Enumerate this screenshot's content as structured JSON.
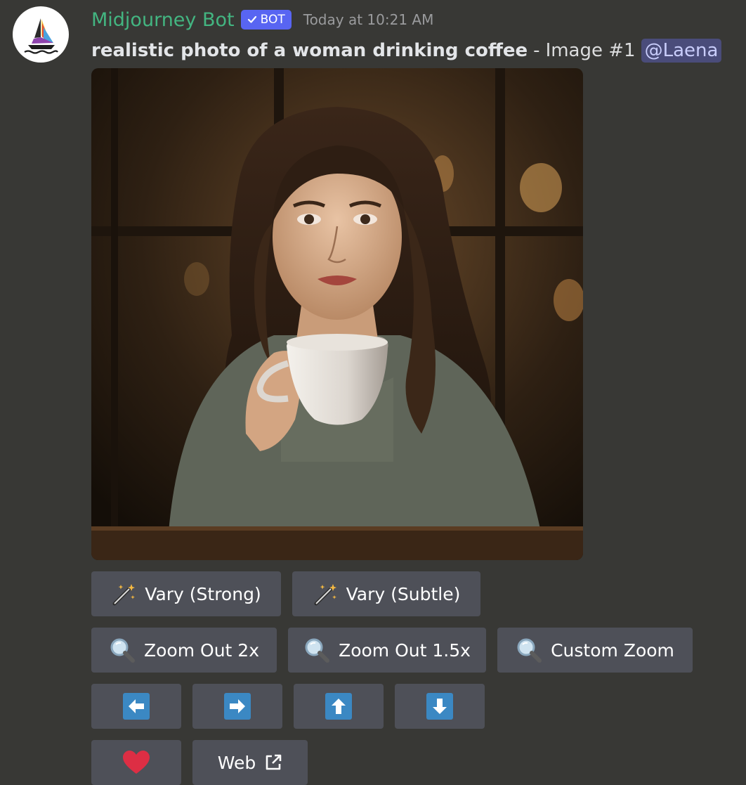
{
  "author": {
    "name": "Midjourney Bot",
    "badge": "BOT",
    "timestamp": "Today at 10:21 AM",
    "avatar_icon": "sailboat-logo-icon"
  },
  "message": {
    "prompt": "realistic photo of a woman drinking coffee",
    "separator": "-",
    "image_label": "Image #1",
    "mention": "@Laena"
  },
  "image": {
    "icon": "generated-photo-woman-drinking-coffee"
  },
  "buttons": {
    "vary_strong": {
      "label": "Vary (Strong)",
      "icon": "magic-wand-icon"
    },
    "vary_subtle": {
      "label": "Vary (Subtle)",
      "icon": "magic-wand-icon"
    },
    "zoom_out_2x": {
      "label": "Zoom Out 2x",
      "icon": "magnifying-glass-icon"
    },
    "zoom_out_1_5x": {
      "label": "Zoom Out 1.5x",
      "icon": "magnifying-glass-icon"
    },
    "custom_zoom": {
      "label": "Custom Zoom",
      "icon": "magnifying-glass-icon"
    },
    "pan_left": {
      "icon": "arrow-left-icon"
    },
    "pan_right": {
      "icon": "arrow-right-icon"
    },
    "pan_up": {
      "icon": "arrow-up-icon"
    },
    "pan_down": {
      "icon": "arrow-down-icon"
    },
    "favorite": {
      "icon": "heart-icon"
    },
    "web": {
      "label": "Web",
      "icon": "external-link-icon"
    }
  },
  "colors": {
    "background": "#383835",
    "bot_name": "#43b581",
    "bot_badge": "#5865f2",
    "button": "#4e5058",
    "arrow_button": "#3b88c3",
    "heart": "#dd2e44"
  }
}
